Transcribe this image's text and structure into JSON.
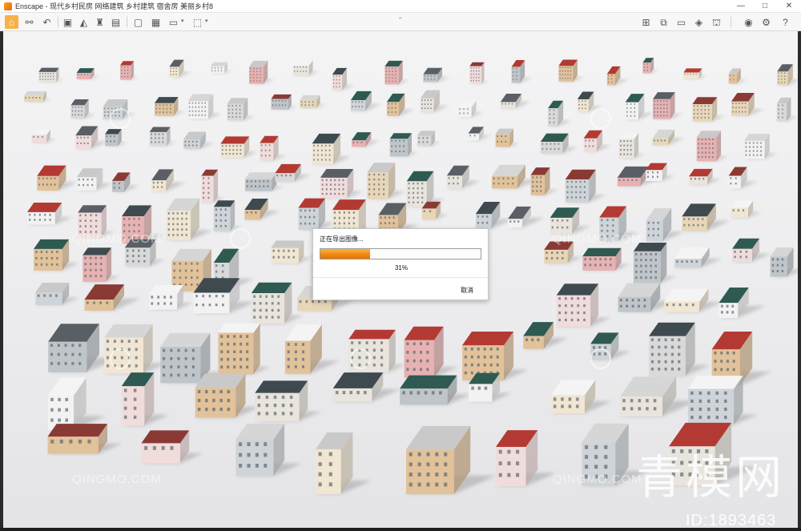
{
  "window": {
    "title": "Enscape - 现代乡村民房 网络建筑 乡村建筑 宿舍房 美丽乡村8",
    "controls": [
      "—",
      "□",
      "✕"
    ]
  },
  "toolbar": {
    "left_icons": [
      "home-icon",
      "connect-icon",
      "undo-icon",
      "view-icon",
      "image-icon",
      "person-icon",
      "building-icon",
      "box-icon",
      "stairs-icon",
      "screenshot-icon",
      "batch-icon",
      "video-icon",
      "export-icon"
    ],
    "right_icons": [
      "map-icon",
      "panorama-icon",
      "monitor-icon",
      "cube-icon",
      "asset-icon",
      "eye-icon",
      "settings-icon",
      "help-icon"
    ]
  },
  "dialog": {
    "title": "正在导出图像...",
    "progress_fraction": 0.31,
    "progress_label": "31%",
    "cancel_label": "取消"
  },
  "watermarks": {
    "site": "QINGMO.COM",
    "brand": "青模网",
    "id": "ID:1893463"
  },
  "colors": {
    "accent": "#f08a12",
    "roof_red": "#b33a33",
    "roof_green": "#2f5a52",
    "wall_beige": "#e8d6b8",
    "wall_pink": "#e7b2b2"
  }
}
